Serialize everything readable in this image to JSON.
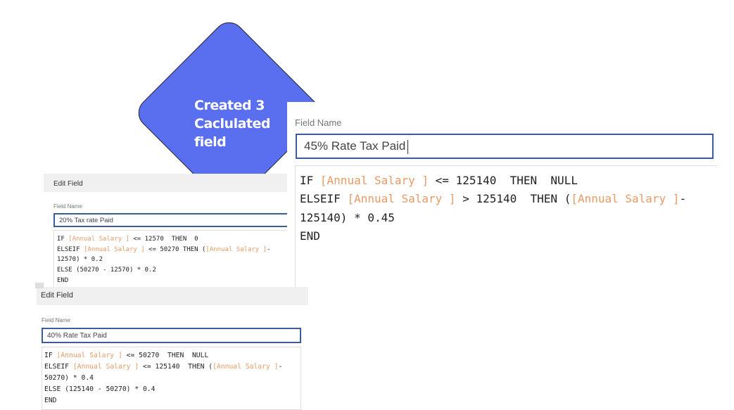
{
  "callout": {
    "text": "Created 3\nCaclulated\nfield",
    "color": "#5a6ff0"
  },
  "panels": [
    {
      "title": "Edit Field",
      "field_label": "Field Name",
      "field_value": "20% Tax rate Paid",
      "code": [
        [
          [
            "IF ",
            0
          ],
          [
            "[Annual Salary ]",
            1
          ],
          [
            " <= 12570  THEN  0",
            0
          ]
        ],
        [
          [
            "ELSEIF ",
            0
          ],
          [
            "[Annual Salary ]",
            1
          ],
          [
            " <= 50270 THEN (",
            0
          ],
          [
            "[Annual Salary ]",
            1
          ],
          [
            "-",
            0
          ]
        ],
        [
          [
            "12570) * 0.2",
            0
          ]
        ],
        [
          [
            "ELSE (50270 - 12570) * 0.2",
            0
          ]
        ],
        [
          [
            "END",
            0
          ]
        ]
      ]
    },
    {
      "title": "Edit Field",
      "field_label": "Field Name",
      "field_value": "40% Rate Tax Paid",
      "code": [
        [
          [
            "IF ",
            0
          ],
          [
            "[Annual Salary ]",
            1
          ],
          [
            " <= 50270  THEN  NULL",
            0
          ]
        ],
        [
          [
            "ELSEIF ",
            0
          ],
          [
            "[Annual Salary ]",
            1
          ],
          [
            " <= 125140  THEN (",
            0
          ],
          [
            "[Annual Salary ]",
            1
          ],
          [
            "-",
            0
          ]
        ],
        [
          [
            "50270) * 0.4",
            0
          ]
        ],
        [
          [
            "ELSE (125140 - 50270) * 0.4",
            0
          ]
        ],
        [
          [
            "END",
            0
          ]
        ]
      ]
    },
    {
      "field_label": "Field Name",
      "field_value": "45% Rate Tax Paid",
      "code": [
        [
          [
            "IF ",
            0
          ],
          [
            "[Annual Salary ]",
            1
          ],
          [
            " <= 125140  THEN  NULL",
            0
          ]
        ],
        [
          [
            "ELSEIF ",
            0
          ],
          [
            "[Annual Salary ]",
            1
          ],
          [
            " > 125140  THEN (",
            0
          ],
          [
            "[Annual Salary ]",
            1
          ],
          [
            "-",
            0
          ]
        ],
        [
          [
            "125140) * 0.45",
            0
          ]
        ],
        [
          [
            "END",
            0
          ]
        ]
      ]
    }
  ],
  "colors": {
    "field_ref": "#e89a66",
    "input_border": "#3c5a9e"
  }
}
